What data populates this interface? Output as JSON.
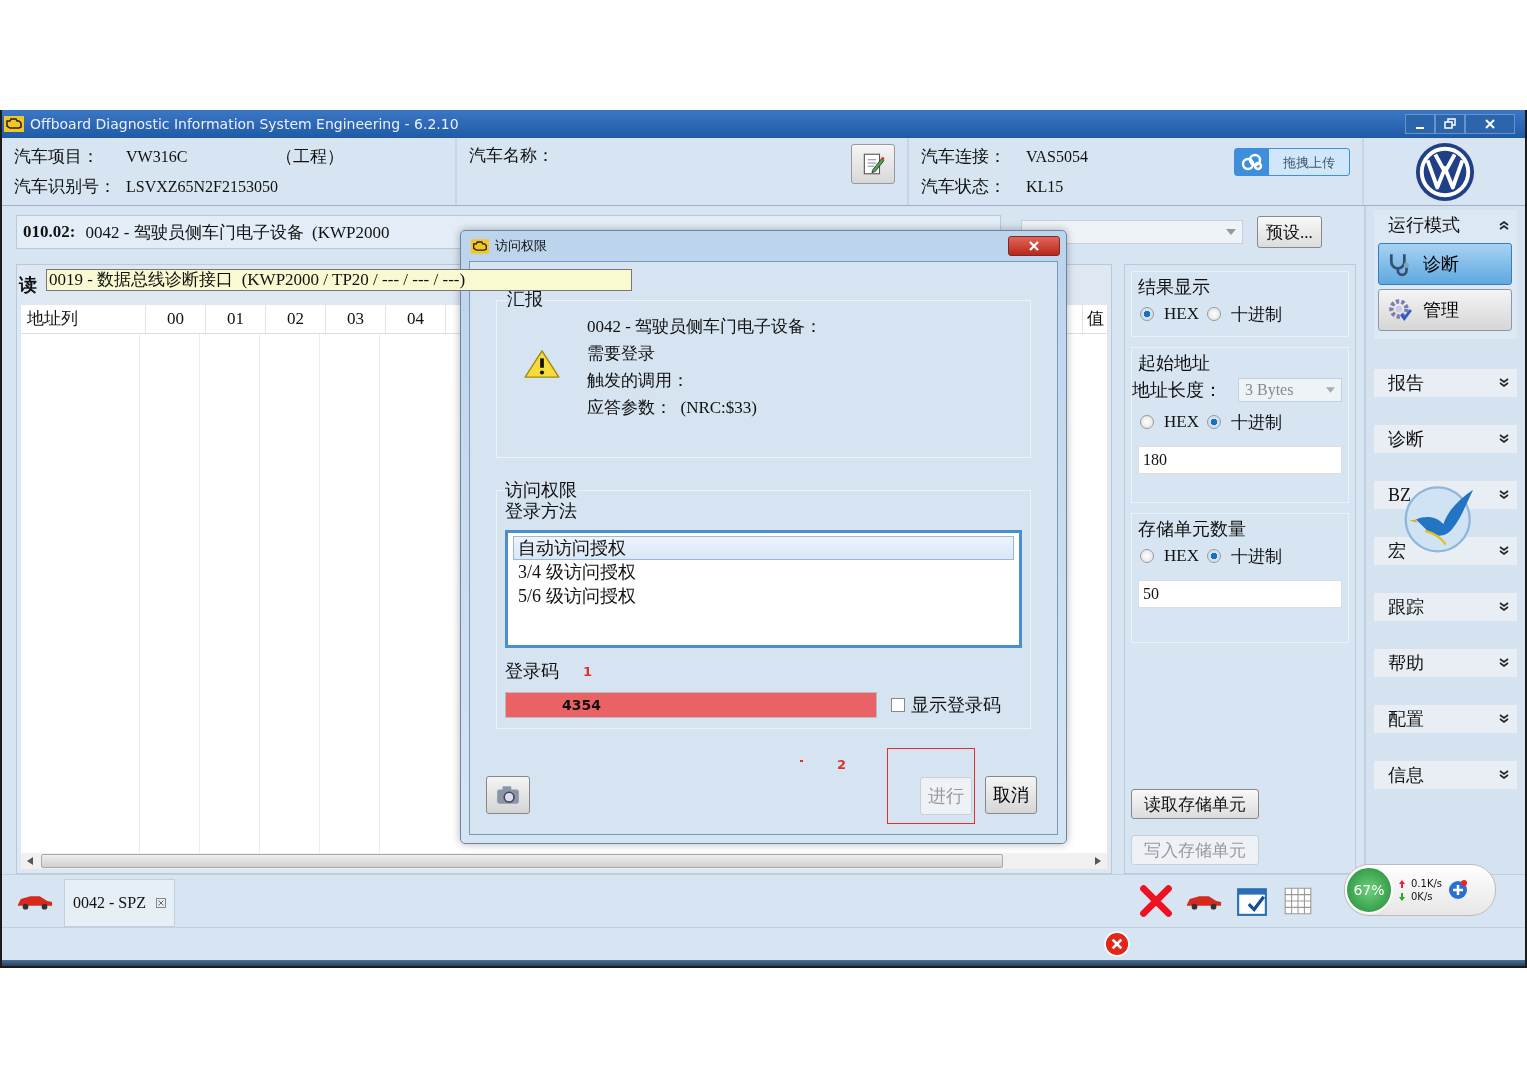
{
  "window": {
    "title": "Offboard Diagnostic Information System Engineering - 6.2.10"
  },
  "vehicle_info": [
    {
      "label": "汽车项目：",
      "value": "VW316C",
      "note": "（工程）"
    },
    {
      "label": "汽车识别号：",
      "value": "LSVXZ65N2F2153050"
    }
  ],
  "vehicle_name": {
    "label": "汽车名称："
  },
  "connection_info": [
    {
      "label": "汽车连接：",
      "value": "VAS5054"
    },
    {
      "label": "汽车状态：",
      "value": "KL15"
    }
  ],
  "upload_button": {
    "label": "拖拽上传"
  },
  "control_unit": {
    "address": "010.02:",
    "text": "0042 - 驾驶员侧车门电子设备  (KWP2000"
  },
  "preset_button": {
    "label": "预设..."
  },
  "read_panel": {
    "title": "读",
    "tooltip": "0019 - 数据总线诊断接口  (KWP2000 / TP20 / --- / --- / ---)",
    "columns": [
      "地址列",
      "00",
      "01",
      "02",
      "03",
      "04"
    ],
    "last_column": "值"
  },
  "dialog": {
    "title": "访问权限",
    "report": {
      "title": "汇报",
      "lines": [
        "0042 - 驾驶员侧车门电子设备：",
        "需要登录",
        "触发的调用：",
        "应答参数：  (NRC:$33)"
      ]
    },
    "access": {
      "title": "访问权限",
      "method_label": "登录方法",
      "methods": [
        {
          "label": "自动访问授权",
          "selected": true
        },
        {
          "label": "3/4 级访问授权",
          "selected": false
        },
        {
          "label": "5/6 级访问授权",
          "selected": false
        }
      ],
      "code_label": "登录码",
      "code_marker": "1",
      "code_value": "4354",
      "show_code": {
        "label": "显示登录码",
        "checked": false
      }
    },
    "step_marker": "2",
    "buttons": [
      {
        "label": "进行",
        "disabled": true,
        "highlighted": true
      },
      {
        "label": "取消",
        "disabled": false,
        "highlighted": false
      }
    ]
  },
  "result_display": {
    "title": "结果显示",
    "options": [
      {
        "label": "HEX",
        "selected": true
      },
      {
        "label": "十进制",
        "selected": false
      }
    ]
  },
  "start_address": {
    "title": "起始地址",
    "length_label": "地址长度：",
    "length_value": "3 Bytes",
    "options": [
      {
        "label": "HEX",
        "selected": false
      },
      {
        "label": "十进制",
        "selected": true
      }
    ],
    "value": "180"
  },
  "cell_count": {
    "title": "存储单元数量",
    "options": [
      {
        "label": "HEX",
        "selected": false
      },
      {
        "label": "十进制",
        "selected": true
      }
    ],
    "value": "50"
  },
  "actions": [
    {
      "label": "读取存储单元",
      "disabled": false
    },
    {
      "label": "写入存储单元",
      "disabled": true
    }
  ],
  "sidebar": {
    "mode": {
      "title": "运行模式",
      "expanded": true,
      "items": [
        {
          "label": "诊断",
          "kind": "diagnose",
          "selected": true
        },
        {
          "label": "管理",
          "kind": "manage",
          "selected": false
        }
      ]
    },
    "sections": [
      {
        "label": "报告",
        "expanded": false
      },
      {
        "label": "诊断",
        "expanded": false
      },
      {
        "label": "BZ",
        "expanded": false
      },
      {
        "label": "宏",
        "expanded": false
      },
      {
        "label": "跟踪",
        "expanded": false
      },
      {
        "label": "帮助",
        "expanded": false
      },
      {
        "label": "配置",
        "expanded": false
      },
      {
        "label": "信息",
        "expanded": false
      }
    ]
  },
  "bottom": {
    "tab": {
      "label": "0042 - SPZ"
    },
    "network": {
      "percent": "67%",
      "upload": "0.1K/s",
      "download": "0K/s"
    }
  }
}
